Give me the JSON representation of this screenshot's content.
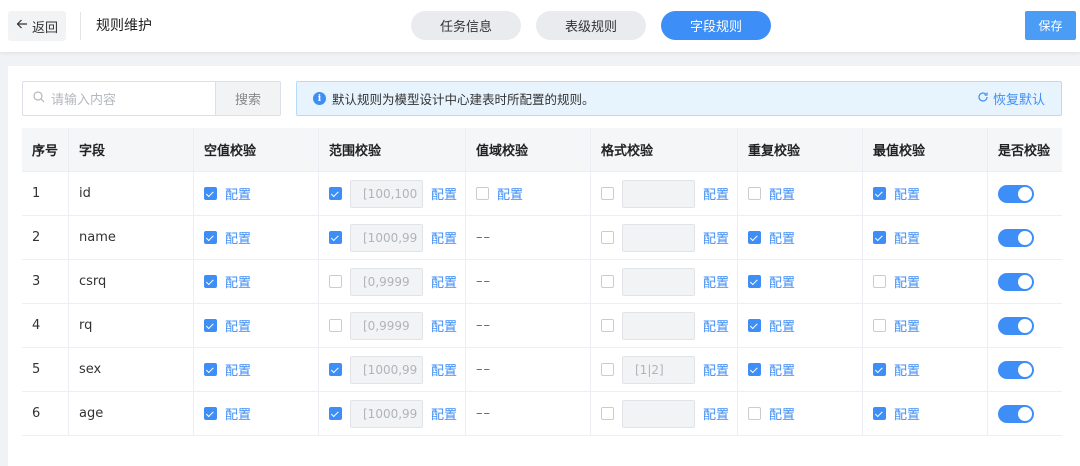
{
  "header": {
    "back_label": "返回",
    "title": "规则维护",
    "tabs": [
      {
        "label": "任务信息",
        "active": false
      },
      {
        "label": "表级规则",
        "active": false
      },
      {
        "label": "字段规则",
        "active": true
      }
    ],
    "save_label": "保存"
  },
  "toolbar": {
    "search_placeholder": "请输入内容",
    "search_button": "搜索",
    "notice_text": "默认规则为模型设计中心建表时所配置的规则。",
    "restore_label": "恢复默认"
  },
  "table": {
    "columns": [
      "序号",
      "字段",
      "空值校验",
      "范围校验",
      "值域校验",
      "格式校验",
      "重复校验",
      "最值校验",
      "是否校验"
    ],
    "config_label": "配置",
    "rows": [
      {
        "index": "1",
        "field": "id",
        "null_check": true,
        "range_check": true,
        "range_value": "[100,100",
        "domain_check": false,
        "domain_na": false,
        "format_check": false,
        "format_value": "",
        "dup_check": false,
        "max_check": true,
        "enabled": true
      },
      {
        "index": "2",
        "field": "name",
        "null_check": true,
        "range_check": true,
        "range_value": "[1000,99",
        "domain_check": false,
        "domain_na": true,
        "format_check": false,
        "format_value": "",
        "dup_check": true,
        "max_check": true,
        "enabled": true
      },
      {
        "index": "3",
        "field": "csrq",
        "null_check": true,
        "range_check": false,
        "range_value": "[0,9999",
        "domain_check": false,
        "domain_na": true,
        "format_check": false,
        "format_value": "",
        "dup_check": true,
        "max_check": false,
        "enabled": true
      },
      {
        "index": "4",
        "field": "rq",
        "null_check": true,
        "range_check": false,
        "range_value": "[0,9999",
        "domain_check": false,
        "domain_na": true,
        "format_check": false,
        "format_value": "",
        "dup_check": true,
        "max_check": false,
        "enabled": true
      },
      {
        "index": "5",
        "field": "sex",
        "null_check": true,
        "range_check": true,
        "range_value": "[1000,99",
        "domain_check": false,
        "domain_na": true,
        "format_check": false,
        "format_value": "[1|2]",
        "dup_check": true,
        "max_check": true,
        "enabled": true
      },
      {
        "index": "6",
        "field": "age",
        "null_check": true,
        "range_check": true,
        "range_value": "[1000,99",
        "domain_check": false,
        "domain_na": true,
        "format_check": false,
        "format_value": "",
        "dup_check": false,
        "max_check": true,
        "enabled": true
      }
    ],
    "na_mark": "––"
  },
  "colors": {
    "accent": "#3e8ef7",
    "notice_bg": "#e8f4fd"
  }
}
